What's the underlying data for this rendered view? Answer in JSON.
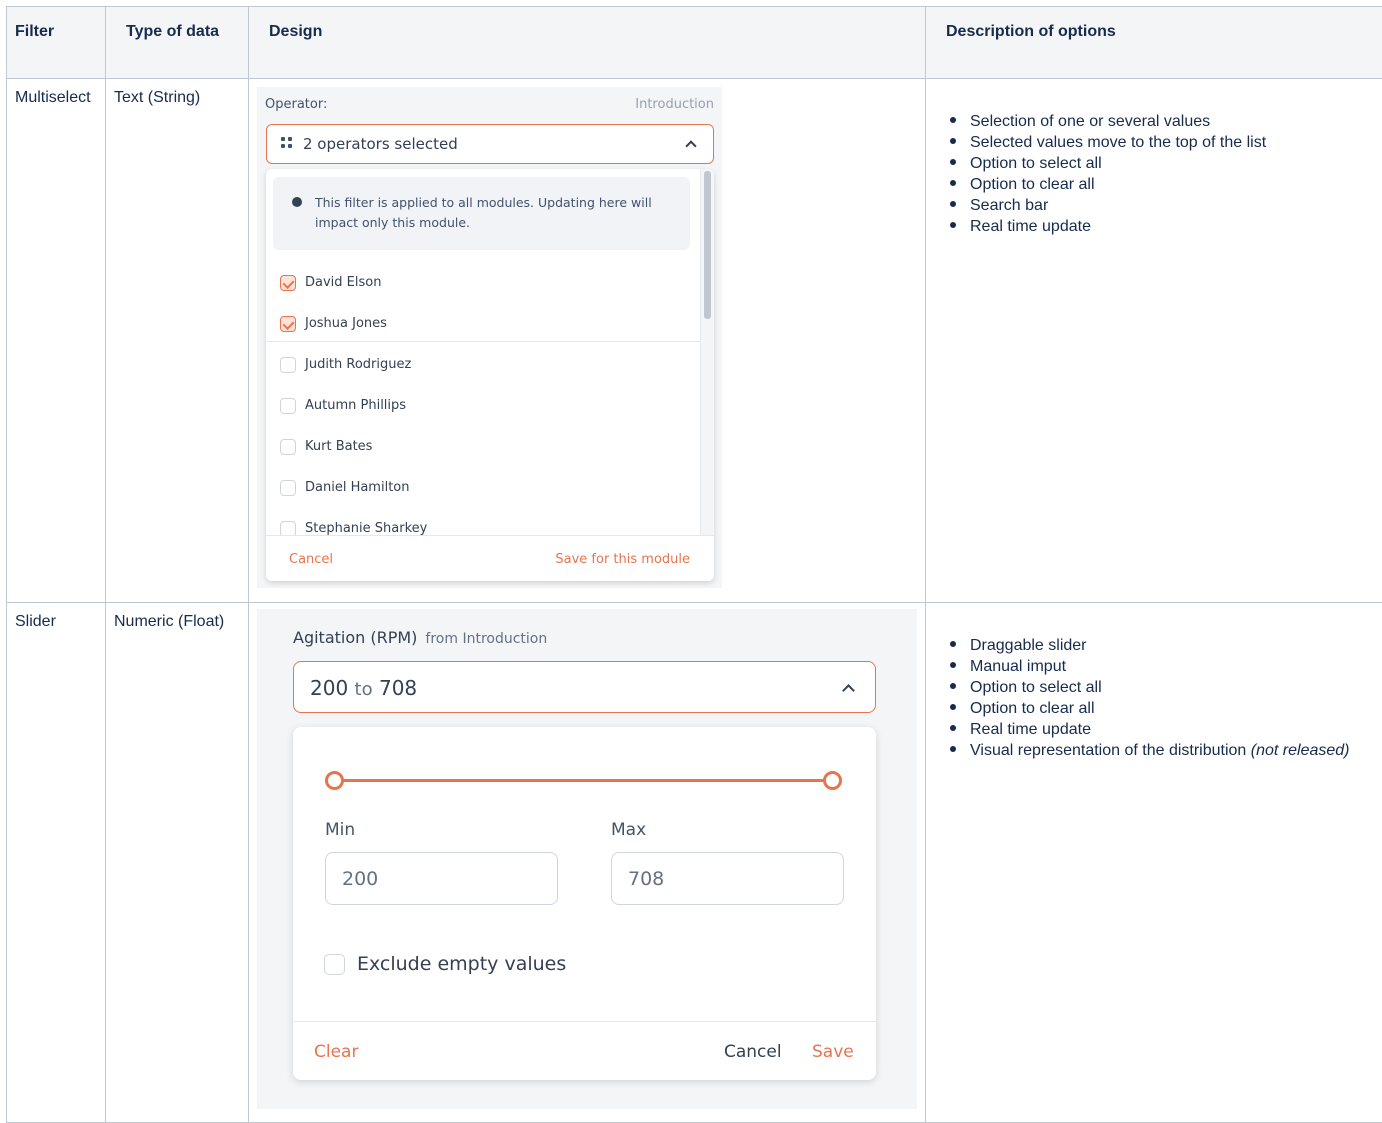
{
  "headers": {
    "filter": "Filter",
    "type_of_data": "Type of data",
    "design": "Design",
    "description": "Description of options"
  },
  "rows": [
    {
      "filter": "Multiselect",
      "type": "Text (String)",
      "options": [
        "Selection of one or several values",
        "Selected values move to the top of the list",
        "Option to select all",
        "Option to clear all",
        "Search bar",
        "Real time update"
      ]
    },
    {
      "filter": "Slider",
      "type": "Numeric (Float)",
      "options": [
        "Draggable slider",
        "Manual imput",
        "Option to select all",
        "Option to clear all",
        "Real time update",
        "Visual representation of the distribution"
      ],
      "options_note": "(not released)"
    }
  ],
  "multiselect": {
    "label": "Operator:",
    "source": "Introduction",
    "field_text": "2 operators selected",
    "info_text": "This filter is applied to all modules. Updating here will impact only this module.",
    "items": [
      {
        "label": "David Elson",
        "checked": true
      },
      {
        "label": "Joshua Jones",
        "checked": true
      },
      {
        "label": "Judith Rodriguez",
        "checked": false
      },
      {
        "label": "Autumn Phillips",
        "checked": false
      },
      {
        "label": "Kurt Bates",
        "checked": false
      },
      {
        "label": "Daniel Hamilton",
        "checked": false
      },
      {
        "label": "Stephanie Sharkey",
        "checked": false
      }
    ],
    "cancel_label": "Cancel",
    "save_label": "Save for this module",
    "accent_color": "#e8744f"
  },
  "slider": {
    "title": "Agitation (RPM)",
    "from_text": "from Introduction",
    "field_min": "200",
    "field_to": "to",
    "field_max": "708",
    "min_label": "Min",
    "max_label": "Max",
    "min_value": "200",
    "max_value": "708",
    "exclude_label": "Exclude empty values",
    "clear_label": "Clear",
    "cancel_label": "Cancel",
    "save_label": "Save",
    "accent_color": "#e8744f"
  }
}
